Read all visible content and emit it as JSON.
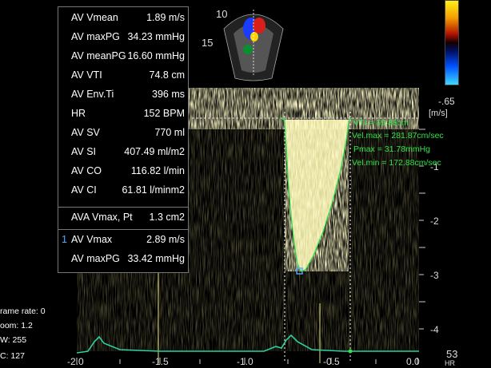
{
  "measurements": [
    {
      "label": "AV Vmean",
      "value": "1.89 m/s"
    },
    {
      "label": "AV maxPG",
      "value": "34.23 mmHg"
    },
    {
      "label": "AV meanPG",
      "value": "16.60 mmHg"
    },
    {
      "label": "AV VTI",
      "value": "74.8 cm"
    },
    {
      "label": "AV Env.Ti",
      "value": "396 ms"
    },
    {
      "label": "HR",
      "value": "152 BPM"
    },
    {
      "label": "AV SV",
      "value": "770 ml"
    },
    {
      "label": "AV SI",
      "value": "407.49 ml/m2"
    },
    {
      "label": "AV CO",
      "value": "116.82 l/min"
    },
    {
      "label": "AV CI",
      "value": "61.81 l/minm2"
    }
  ],
  "ava": {
    "label": "AVA Vmax, Pt",
    "value": "1.3 cm2"
  },
  "selected": [
    {
      "index": "1",
      "label": "AV Vmax",
      "value": "2.89 m/s"
    },
    {
      "index": "",
      "label": "AV maxPG",
      "value": "33.42 mmHg"
    }
  ],
  "trace_annotation": {
    "vti": "VTI = 69.88cm",
    "vmax": "Vel.max = 281.87cm/sec",
    "pmax": "Pmax = 31.78mmHg",
    "vmin": "Vel.min = 172.88cm/sec"
  },
  "sector": {
    "depth_top": "10",
    "depth_mid": "15"
  },
  "scale": {
    "unit": "[m/s]",
    "top_value": "-.65",
    "velocity_ticks": [
      "-1",
      "-2",
      "-3",
      "-4"
    ],
    "time_ticks": [
      "-2.0",
      "-1.5",
      "-1.0",
      "-0.5",
      "0.0"
    ]
  },
  "info": {
    "frame_rate": "rame rate: 0",
    "zoom": "oom: 1.2",
    "pw": "W: 255",
    "vc": "C: 127"
  },
  "hr_readout": {
    "value": "53",
    "unit": "HR"
  },
  "colors": {
    "trace": "#30e34a",
    "ecg": "#2ccfa0",
    "spectrum": "#e8df7a"
  }
}
